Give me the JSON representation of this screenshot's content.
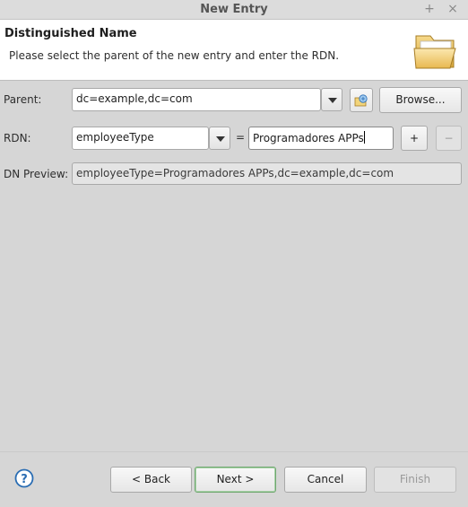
{
  "window": {
    "title": "New Entry",
    "controls": [
      "+",
      "×"
    ]
  },
  "header": {
    "title": "Distinguished Name",
    "description": "Please select the parent of the new entry and enter the RDN.",
    "icon": "folder-icon"
  },
  "form": {
    "parent_label": "Parent:",
    "parent_value": "dc=example,dc=com",
    "browse_label": "Browse...",
    "rdn_label": "RDN:",
    "rdn_type": "employeeType",
    "equals": "=",
    "rdn_value": "Programadores APPs",
    "add_label": "+",
    "remove_label": "−",
    "preview_label": "DN Preview:",
    "preview_value": "employeeType=Programadores APPs,dc=example,dc=com"
  },
  "footer": {
    "help_icon": "help-icon",
    "back_label": "< Back",
    "next_label": "Next >",
    "cancel_label": "Cancel",
    "finish_label": "Finish"
  },
  "colors": {
    "background": "#d6d6d6",
    "header_bg": "#ffffff",
    "default_button_border": "#6fa76f",
    "help_blue": "#2a6db3"
  }
}
